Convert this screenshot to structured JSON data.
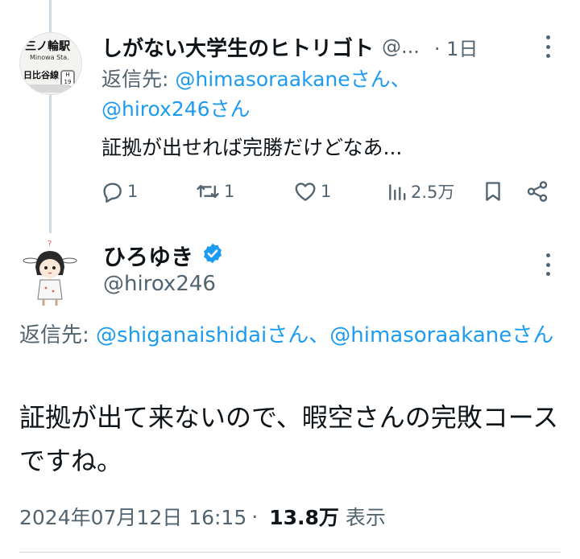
{
  "tweet1": {
    "name": "しがない大学生のヒトリゴト",
    "handle": "@...",
    "time": "· 1日",
    "reply_to_prefix": "返信先: ",
    "reply_to_user1": "@himasoraakaneさん、",
    "reply_to_user2": "@hirox246さん",
    "text": "証拠が出せれば完勝だけどなあ...",
    "avatar": {
      "station": "三ノ輪駅",
      "station_en": "Minowa Sta.",
      "line": "日比谷線",
      "line_code": "H 19"
    },
    "actions": {
      "replies": "1",
      "retweets": "1",
      "likes": "1",
      "views": "2.5万"
    }
  },
  "tweet2": {
    "name": "ひろゆき",
    "handle": "@hirox246",
    "reply_to_prefix": "返信先: ",
    "reply_to_users": "@shiganaishidaiさん、@himasoraakaneさん",
    "text": "証拠が出て来ないので、暇空さんの完敗コースですね。",
    "timestamp": "2024年07月12日 16:15",
    "separator": "·",
    "views_count": "13.8万",
    "views_label": "表示"
  },
  "colors": {
    "text": "#0f1419",
    "secondary": "#536471",
    "link": "#1d9bf0",
    "divider": "#cfd9de"
  },
  "icons": [
    "reply-icon",
    "retweet-icon",
    "like-icon",
    "views-icon",
    "bookmark-icon",
    "share-icon",
    "more-icon",
    "verified-icon"
  ]
}
